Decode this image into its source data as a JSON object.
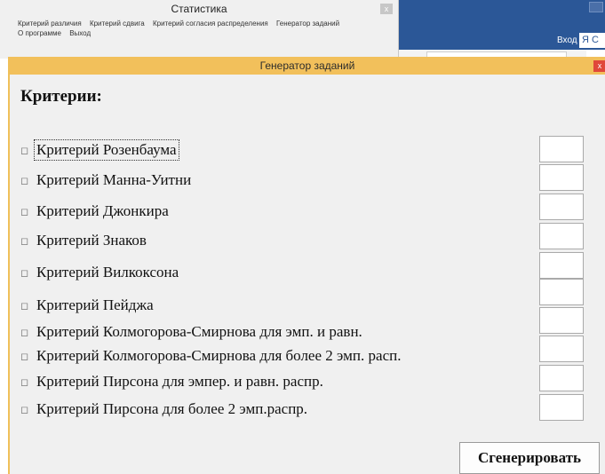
{
  "background_window": {
    "title": "Статистика",
    "close": "x",
    "menu_row1": [
      "Критерий различия",
      "Критерий сдвига",
      "Критерий согласия распределения",
      "Генератор заданий"
    ],
    "menu_row2": [
      "О программе",
      "Выход"
    ]
  },
  "browser": {
    "login": "Вход",
    "user": "Я С"
  },
  "dialog": {
    "title": "Генератор заданий",
    "close": "x",
    "heading": "Критерии:",
    "checkbox_glyph": "◻",
    "criteria": [
      {
        "label": "Критерий Розенбаума",
        "checked": false
      },
      {
        "label": "Критерий Манна-Уитни",
        "checked": false
      },
      {
        "label": "Критерий Джонкира",
        "checked": false
      },
      {
        "label": "Критерий Знаков",
        "checked": false
      },
      {
        "label": "Критерий Вилкоксона",
        "checked": false
      },
      {
        "label": "Критерий Пейджа",
        "checked": false
      },
      {
        "label": "Критерий Колмогорова-Смирнова для эмп. и равн.",
        "checked": false
      },
      {
        "label": "Критерий Колмогорова-Смирнова для более 2 эмп. расп.",
        "checked": false
      },
      {
        "label": "Критерий Пирсона для эмпер. и равн. распр.",
        "checked": false
      },
      {
        "label": "Критерий Пирсона для более 2 эмп.распр.",
        "checked": false
      }
    ],
    "count_inputs": [
      "",
      "",
      "",
      "",
      "",
      "",
      "",
      "",
      "",
      ""
    ],
    "generate_button": "Сгенерировать"
  }
}
